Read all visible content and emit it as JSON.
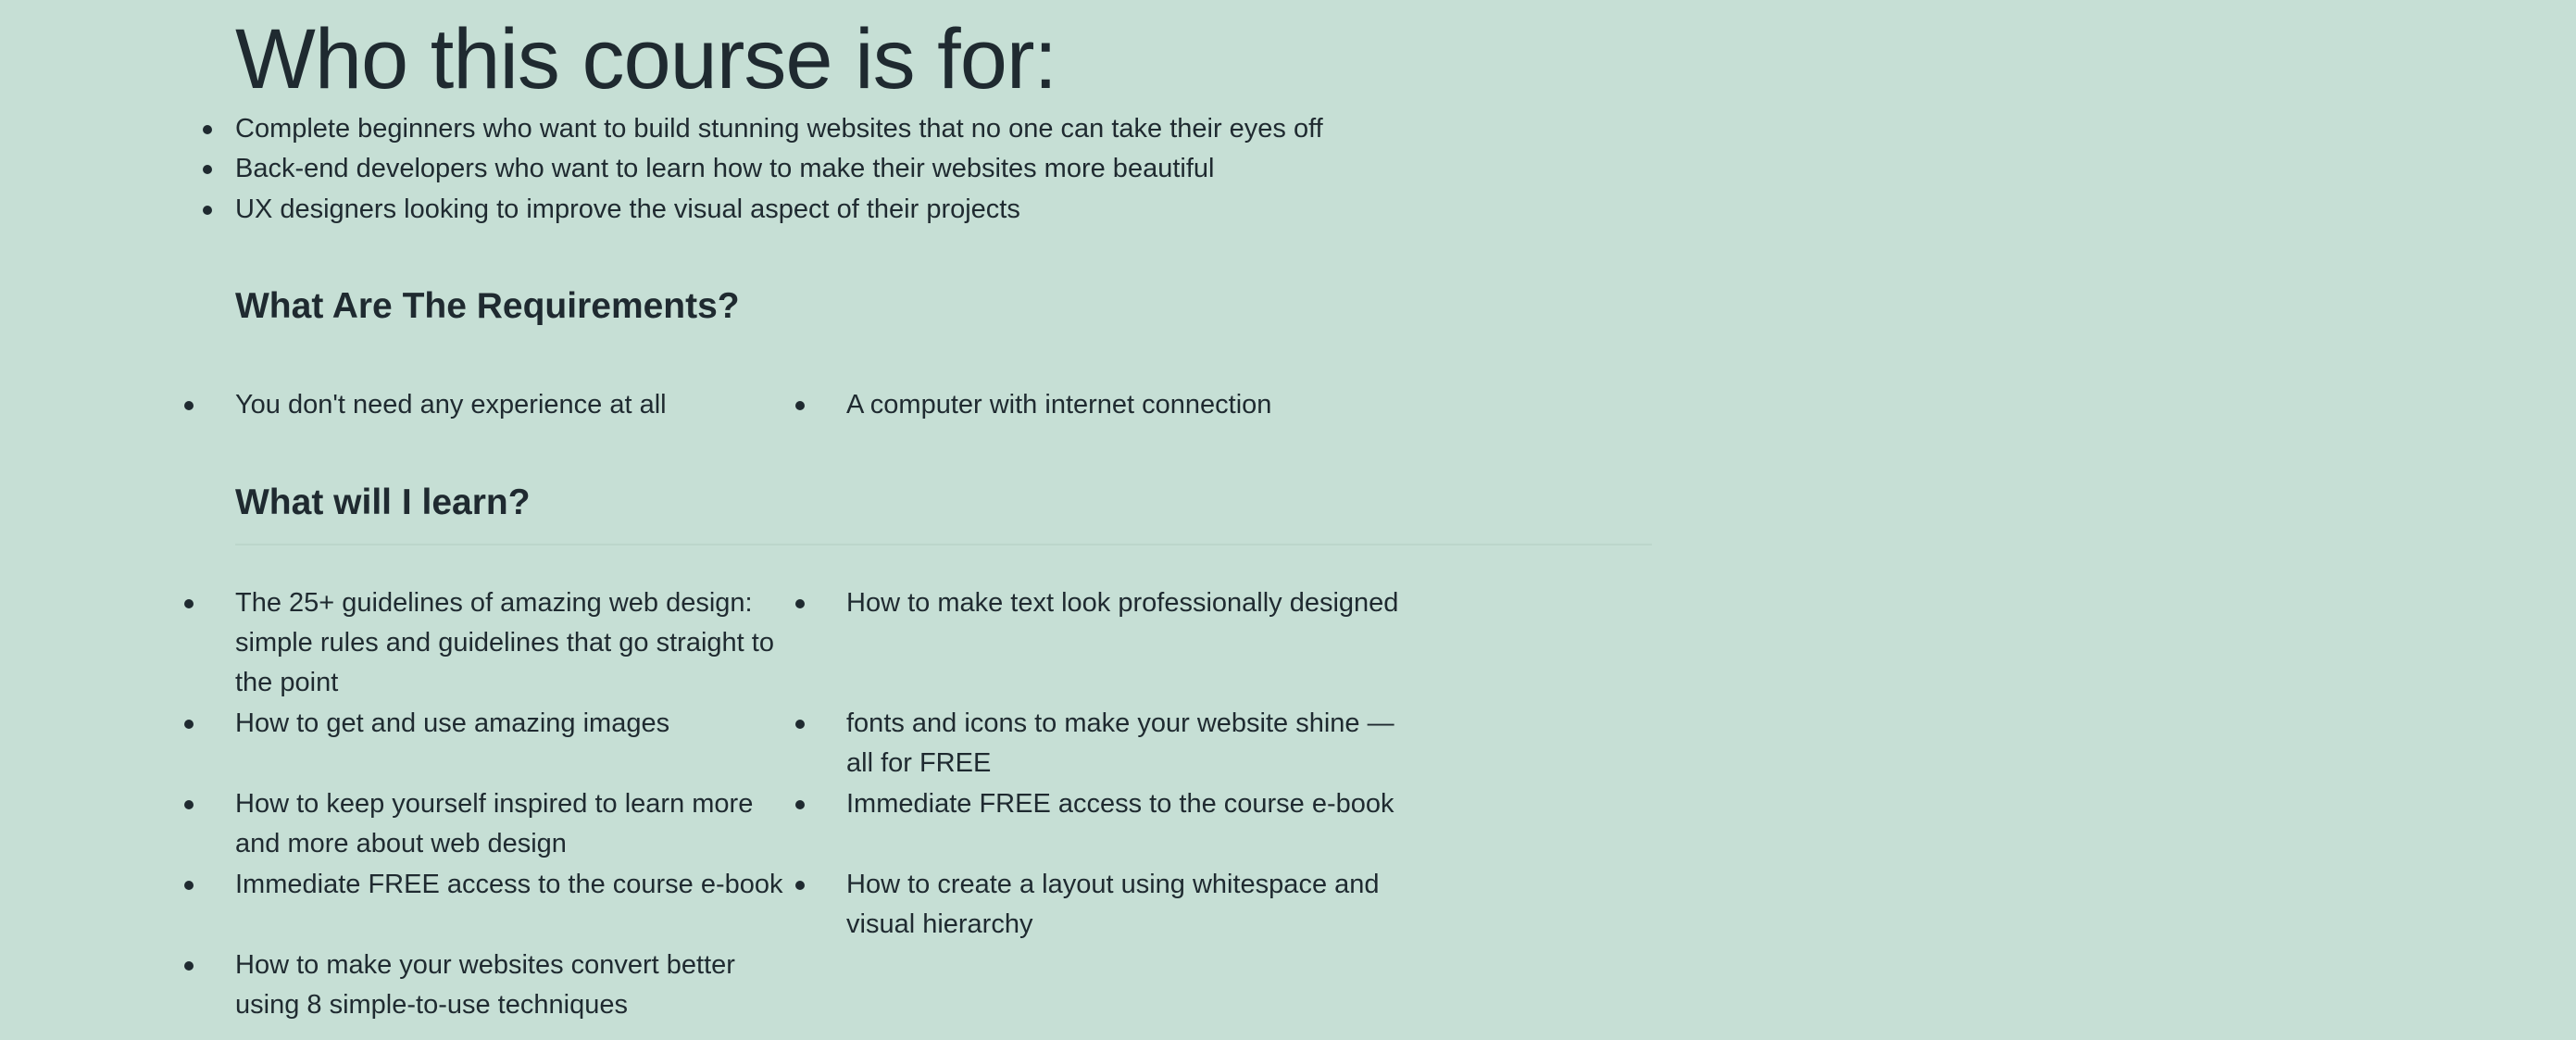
{
  "audience": {
    "title": "Who this course is for:",
    "items": [
      "Complete beginners who want to build stunning websites that no one can take their eyes off",
      "Back-end developers who want to learn how to make their websites more beautiful",
      "UX designers looking to improve the visual aspect of their projects"
    ]
  },
  "requirements": {
    "title": "What Are The Requirements?",
    "items": [
      "You don't need any experience at all",
      "A computer with internet connection"
    ]
  },
  "learn": {
    "title": "What will I learn?",
    "items": [
      "The 25+ guidelines of amazing web design: simple rules and guidelines that go straight to the point",
      "How to make text look professionally designed",
      "How to get and use amazing images",
      "fonts and icons to make your website shine — all for FREE",
      "How to keep yourself inspired to learn more and more about web design",
      "Immediate FREE access to the course e-book",
      "Immediate FREE access to the course e-book",
      "How to create a layout using whitespace and visual hierarchy",
      "How to make your websites convert better using 8 simple-to-use techniques"
    ]
  }
}
